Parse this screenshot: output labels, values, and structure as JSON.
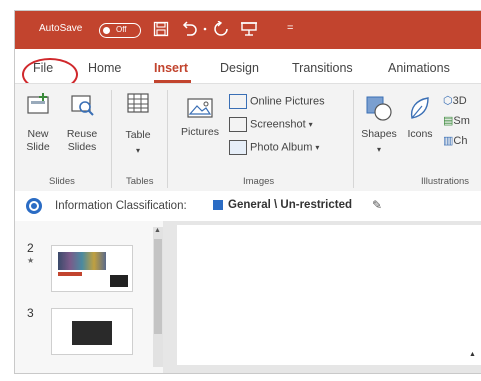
{
  "titlebar": {
    "autosave_label": "AutoSave",
    "autosave_state": "Off",
    "customize_qat": "=",
    "accent_color": "#c2442e"
  },
  "tabs": [
    {
      "label": "File"
    },
    {
      "label": "Home"
    },
    {
      "label": "Insert"
    },
    {
      "label": "Design"
    },
    {
      "label": "Transitions"
    },
    {
      "label": "Animations"
    }
  ],
  "ribbon": {
    "slides_group": {
      "label": "Slides",
      "new_slide": "New\nSlide",
      "reuse_slides": "Reuse\nSlides"
    },
    "tables_group": {
      "label": "Tables",
      "table": "Table"
    },
    "images_group": {
      "label": "Images",
      "pictures": "Pictures",
      "online_pictures": "Online Pictures",
      "screenshot": "Screenshot",
      "photo_album": "Photo Album"
    },
    "illustrations_group": {
      "label": "Illustrations",
      "shapes": "Shapes",
      "icons": "Icons",
      "models_3d": "3D",
      "smartart": "Sm",
      "chart": "Ch"
    }
  },
  "infobar": {
    "label": "Information Classification:",
    "value": "General \\ Un-restricted",
    "badge_color": "#2b6cc4"
  },
  "slides": [
    {
      "number": "2",
      "star": "★"
    },
    {
      "number": "3"
    }
  ]
}
